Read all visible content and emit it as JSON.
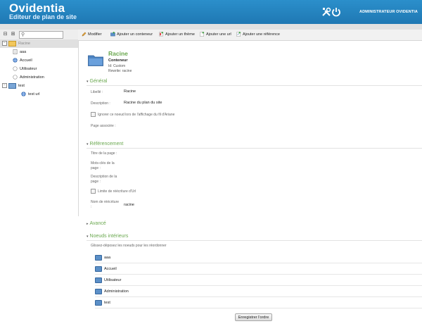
{
  "header": {
    "app_title": "Ovidentia",
    "app_subtitle": "Editeur de plan de site",
    "user_name": "Administrateur Ovidentia",
    "icons": [
      "tools-icon",
      "power-icon"
    ]
  },
  "sidebar": {
    "search_placeholder": "",
    "search_value": "",
    "tree": [
      {
        "label": "Racine",
        "selected": true
      },
      {
        "label": "aaa"
      },
      {
        "label": "Accueil"
      },
      {
        "label": "Utilisateur"
      },
      {
        "label": "Administration"
      },
      {
        "label": "test"
      },
      {
        "label": "test url"
      }
    ],
    "expander_symbol": "−"
  },
  "toolbar": {
    "modify": "Modifier",
    "add_container": "Ajouter un conteneur",
    "add_theme": "Ajouter un thème",
    "add_url": "Ajouter une url",
    "add_reference": "Ajouter une référence"
  },
  "node": {
    "title": "Racine",
    "type": "Conteneur",
    "id_line": "Id: Custom",
    "rewrite_line": "Rewrite: racine"
  },
  "general": {
    "title": "Général",
    "label_label": "Libellé :",
    "label_value": "Racine",
    "description_label": "Description :",
    "description_value": "Racine du plan du site",
    "ignore_checkbox": "Ignorer ce noeud lors de l'affichage du fil d'Ariane",
    "page_label": "Page associée :"
  },
  "referencing": {
    "title": "Référencement",
    "page_title_label": "Titre de la page :",
    "keywords_label": "Mots-clés de la page :",
    "page_description_label": "Description de la page :",
    "limit_checkbox": "Limite de réécriture d'Url",
    "rewrite_name_label": "Nom de réécriture :",
    "rewrite_name_value": "racine"
  },
  "advanced": {
    "title": "Avancé"
  },
  "inner_nodes": {
    "title": "Noeuds intérieurs",
    "hint": "Glissez-déposez les noeuds pour les réordonner",
    "items": [
      "aaa",
      "Accueil",
      "Utilisateur",
      "Administration",
      "test"
    ],
    "save_button": "Enregistrer l'ordre"
  },
  "colors": {
    "header_blue": "#2b8fcb",
    "section_green": "#6aa84f"
  }
}
